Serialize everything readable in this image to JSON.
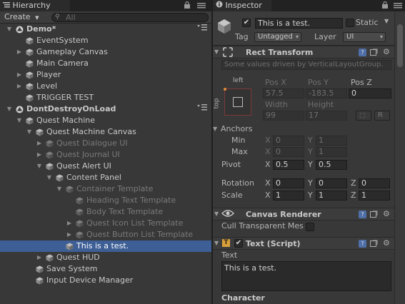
{
  "hierarchy": {
    "tab_label": "Hierarchy",
    "create_label": "Create",
    "search_placeholder": "All",
    "rows": [
      {
        "label": "Demo*",
        "depth": 0,
        "type": "scene",
        "expanded": true,
        "dim": false,
        "has_children": true,
        "selected": false
      },
      {
        "label": "EventSystem",
        "depth": 1,
        "type": "go",
        "dim": false,
        "has_children": false,
        "selected": false
      },
      {
        "label": "Gameplay Canvas",
        "depth": 1,
        "type": "go",
        "dim": false,
        "has_children": true,
        "expanded": false,
        "selected": false
      },
      {
        "label": "Main Camera",
        "depth": 1,
        "type": "go",
        "dim": false,
        "has_children": false,
        "selected": false
      },
      {
        "label": "Player",
        "depth": 1,
        "type": "go",
        "dim": false,
        "has_children": true,
        "expanded": false,
        "selected": false
      },
      {
        "label": "Level",
        "depth": 1,
        "type": "go",
        "dim": false,
        "has_children": true,
        "expanded": false,
        "selected": false
      },
      {
        "label": "TRIGGER TEST",
        "depth": 1,
        "type": "go",
        "dim": false,
        "has_children": false,
        "selected": false
      },
      {
        "label": "DontDestroyOnLoad",
        "depth": 0,
        "type": "scene",
        "expanded": true,
        "dim": false,
        "has_children": true,
        "selected": false
      },
      {
        "label": "Quest Machine",
        "depth": 1,
        "type": "go",
        "dim": false,
        "has_children": true,
        "expanded": true,
        "selected": false
      },
      {
        "label": "Quest Machine Canvas",
        "depth": 2,
        "type": "go",
        "dim": false,
        "has_children": true,
        "expanded": true,
        "selected": false
      },
      {
        "label": "Quest Dialogue UI",
        "depth": 3,
        "type": "go",
        "dim": true,
        "has_children": true,
        "expanded": false,
        "selected": false
      },
      {
        "label": "Quest Journal UI",
        "depth": 3,
        "type": "go",
        "dim": true,
        "has_children": true,
        "expanded": false,
        "selected": false
      },
      {
        "label": "Quest Alert UI",
        "depth": 3,
        "type": "go",
        "dim": false,
        "has_children": true,
        "expanded": true,
        "selected": false
      },
      {
        "label": "Content Panel",
        "depth": 4,
        "type": "go",
        "dim": false,
        "has_children": true,
        "expanded": true,
        "selected": false
      },
      {
        "label": "Container Template",
        "depth": 5,
        "type": "go",
        "dim": true,
        "has_children": true,
        "expanded": true,
        "selected": false
      },
      {
        "label": "Heading Text Template",
        "depth": 6,
        "type": "go",
        "dim": true,
        "has_children": false,
        "selected": false
      },
      {
        "label": "Body Text Template",
        "depth": 6,
        "type": "go",
        "dim": true,
        "has_children": false,
        "selected": false
      },
      {
        "label": "Quest Icon List Template",
        "depth": 6,
        "type": "go",
        "dim": true,
        "has_children": true,
        "expanded": false,
        "selected": false
      },
      {
        "label": "Quest Button List Template",
        "depth": 6,
        "type": "go",
        "dim": true,
        "has_children": true,
        "expanded": false,
        "selected": false
      },
      {
        "label": "This is a test.",
        "depth": 5,
        "type": "go",
        "dim": false,
        "has_children": false,
        "selected": true
      },
      {
        "label": "Quest HUD",
        "depth": 3,
        "type": "go",
        "dim": false,
        "has_children": true,
        "expanded": false,
        "selected": false
      },
      {
        "label": "Save System",
        "depth": 2,
        "type": "go",
        "dim": false,
        "has_children": false,
        "selected": false
      },
      {
        "label": "Input Device Manager",
        "depth": 2,
        "type": "go",
        "dim": false,
        "has_children": false,
        "selected": false
      }
    ]
  },
  "inspector": {
    "tab_label": "Inspector",
    "object_name": "This is a test.",
    "active_checked": true,
    "static_label": "Static",
    "static_checked": false,
    "tag_label": "Tag",
    "tag_value": "Untagged",
    "layer_label": "Layer",
    "layer_value": "UI",
    "rect_transform": {
      "title": "Rect Transform",
      "driven_note": "Some values driven by VerticalLayoutGroup.",
      "anchor_h": "left",
      "anchor_v": "top",
      "pos_x_label": "Pos X",
      "pos_y_label": "Pos Y",
      "pos_z_label": "Pos Z",
      "pos_x": "57.5",
      "pos_y": "-183.5",
      "pos_z": "0",
      "width_label": "Width",
      "height_label": "Height",
      "width": "99",
      "height": "17",
      "r_button": "R",
      "anchors_label": "Anchors",
      "min_label": "Min",
      "max_label": "Max",
      "min_x": "0",
      "min_y": "1",
      "max_x": "0",
      "max_y": "1",
      "pivot_label": "Pivot",
      "pivot_x": "0.5",
      "pivot_y": "0.5",
      "rotation_label": "Rotation",
      "rot_x": "0",
      "rot_y": "0",
      "rot_z": "0",
      "scale_label": "Scale",
      "scale_x": "1",
      "scale_y": "1",
      "scale_z": "1",
      "x_letter": "X",
      "y_letter": "Y",
      "z_letter": "Z"
    },
    "canvas_renderer": {
      "title": "Canvas Renderer",
      "cull_label": "Cull Transparent Mes",
      "cull_checked": false
    },
    "text_script": {
      "title": "Text (Script)",
      "enabled": true,
      "text_label": "Text",
      "text_value": "This is a test.",
      "character_label": "Character"
    }
  }
}
